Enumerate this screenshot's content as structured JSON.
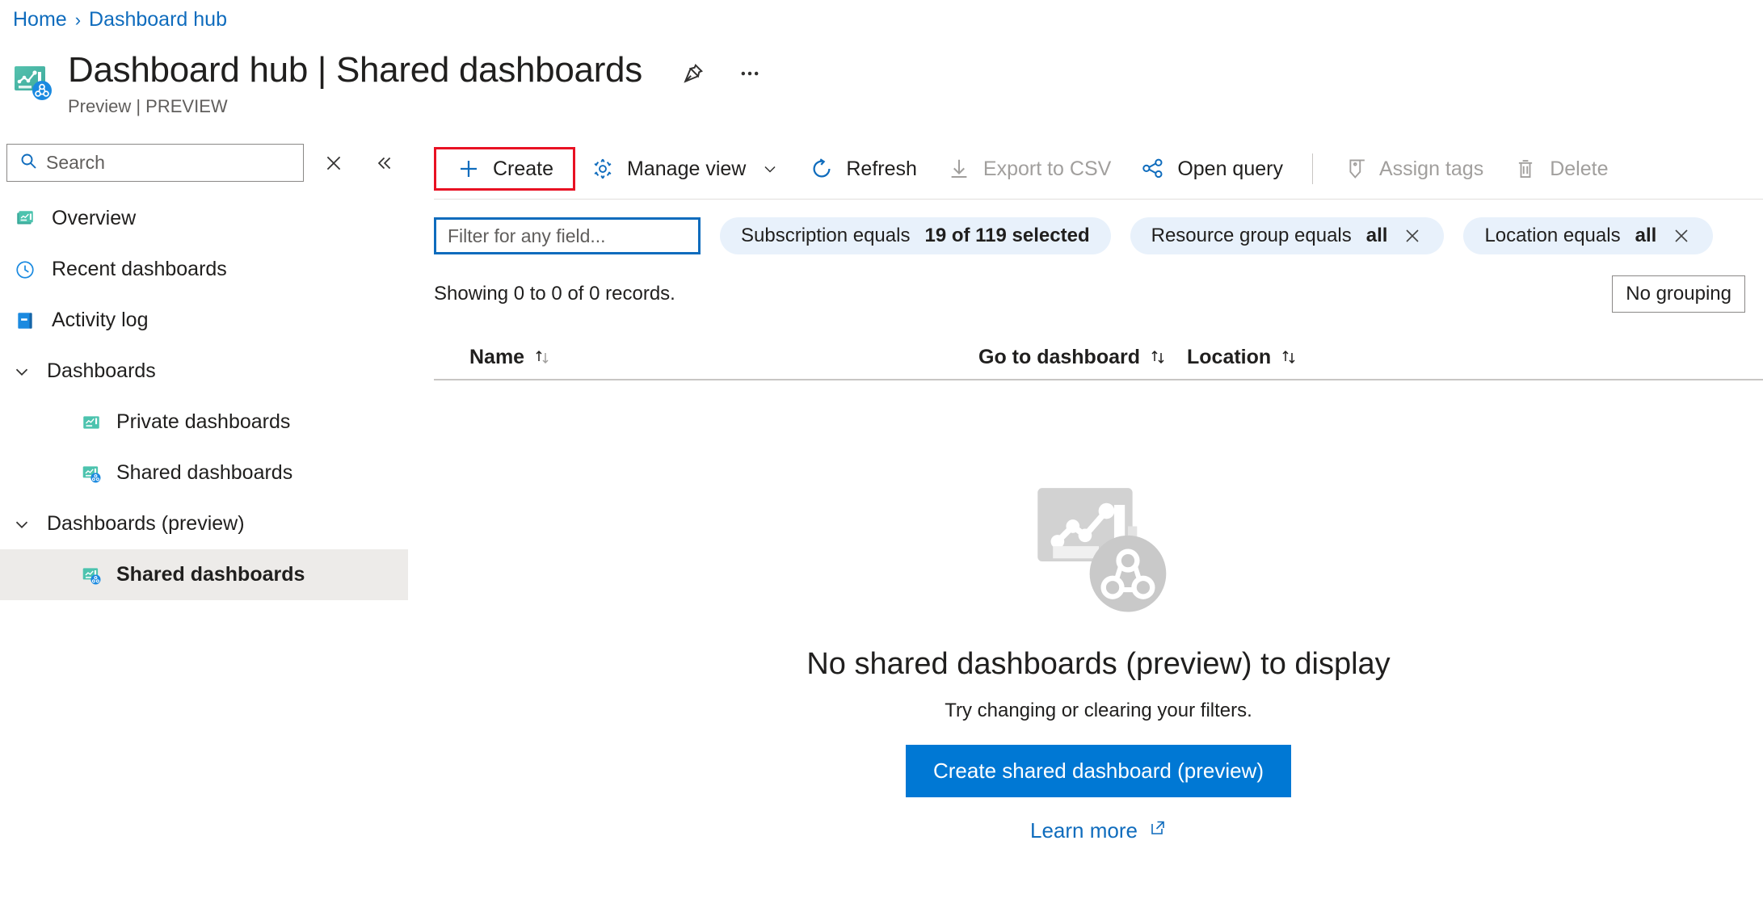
{
  "breadcrumb": {
    "items": [
      {
        "label": "Home"
      },
      {
        "label": "Dashboard hub"
      }
    ],
    "separator": "›"
  },
  "header": {
    "title": "Dashboard hub | Shared dashboards",
    "subtitle": "Preview | PREVIEW",
    "icon": "dashboard-hub-shared-icon",
    "actions": [
      {
        "name": "pin-icon",
        "label": "Pin"
      },
      {
        "name": "more-icon",
        "label": "More"
      }
    ]
  },
  "sidebar": {
    "search": {
      "placeholder": "Search",
      "value": "",
      "icon": "search-icon"
    },
    "clear_label": "✕",
    "collapse_label": "«",
    "items": [
      {
        "label": "Overview",
        "icon": "dashboard-icon",
        "type": "item",
        "selected": false
      },
      {
        "label": "Recent dashboards",
        "icon": "clock-icon",
        "type": "item",
        "selected": false
      },
      {
        "label": "Activity log",
        "icon": "activity-log-icon",
        "type": "item",
        "selected": false
      },
      {
        "label": "Dashboards",
        "icon": "chevron-down-icon",
        "type": "group",
        "selected": false
      },
      {
        "label": "Private dashboards",
        "icon": "private-dashboard-icon",
        "type": "child",
        "selected": false
      },
      {
        "label": "Shared dashboards",
        "icon": "shared-dashboard-icon",
        "type": "child",
        "selected": false
      },
      {
        "label": "Dashboards (preview)",
        "icon": "chevron-down-icon",
        "type": "group",
        "selected": false
      },
      {
        "label": "Shared dashboards",
        "icon": "shared-dashboard-icon",
        "type": "child",
        "selected": true
      }
    ]
  },
  "toolbar": {
    "create_label": "Create",
    "manage_view_label": "Manage view",
    "refresh_label": "Refresh",
    "export_csv_label": "Export to CSV",
    "open_query_label": "Open query",
    "assign_tags_label": "Assign tags",
    "delete_label": "Delete",
    "highlight_color": "#e81123"
  },
  "filters": {
    "input": {
      "placeholder": "Filter for any field...",
      "value": ""
    },
    "pills": [
      {
        "prefix": "Subscription equals",
        "value": "19 of 119 selected",
        "dismissible": false
      },
      {
        "prefix": "Resource group equals",
        "value": "all",
        "dismissible": true
      },
      {
        "prefix": "Location equals",
        "value": "all",
        "dismissible": true
      }
    ],
    "pill_color": "#e8f1fb"
  },
  "results": {
    "records_text": "Showing 0 to 0 of 0 records.",
    "grouping": {
      "selected": "No grouping"
    }
  },
  "table": {
    "columns": [
      {
        "label": "Name",
        "sortable": true
      },
      {
        "label": "Go to dashboard",
        "sortable": true
      },
      {
        "label": "Location",
        "sortable": true
      }
    ],
    "rows": []
  },
  "empty_state": {
    "illustration": "shared-dashboard-placeholder-icon",
    "title": "No shared dashboards (preview) to display",
    "subtitle": "Try changing or clearing your filters.",
    "cta_label": "Create shared dashboard (preview)",
    "cta_color": "#0078d4",
    "learn_more_label": "Learn more",
    "learn_more_icon": "external-link-icon"
  }
}
